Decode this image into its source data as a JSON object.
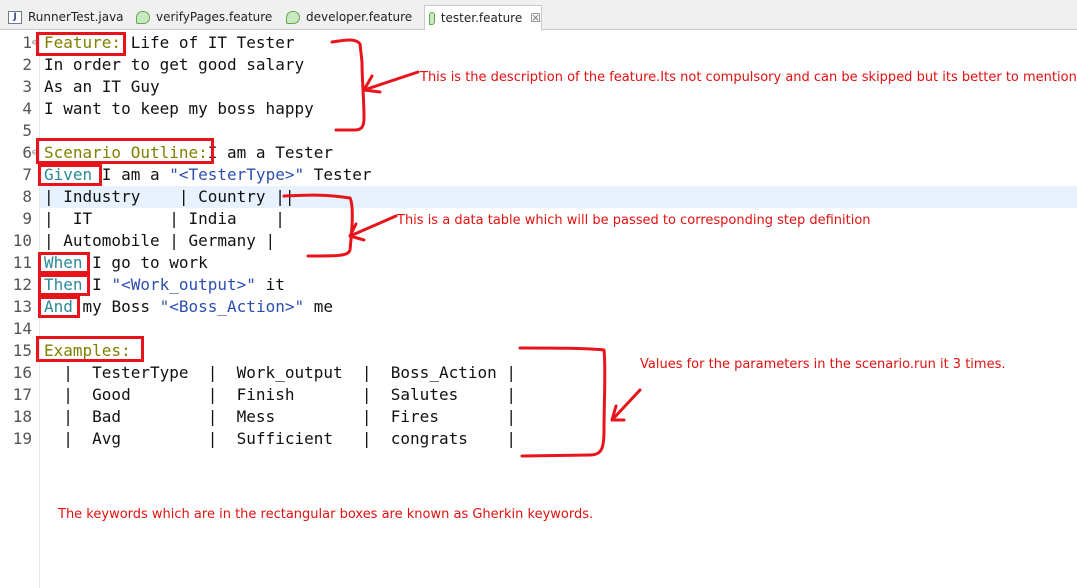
{
  "tabs": [
    {
      "label": "RunnerTest.java",
      "icon": "java-file-icon"
    },
    {
      "label": "verifyPages.feature",
      "icon": "feature-file-icon"
    },
    {
      "label": "developer.feature",
      "icon": "feature-file-icon"
    },
    {
      "label": "tester.feature",
      "icon": "feature-file-icon",
      "active": true,
      "close": "☒"
    }
  ],
  "editor": {
    "lines": [
      {
        "n": "1",
        "parts": [
          [
            "kw1",
            "Feature:"
          ],
          [
            "t",
            " Life of IT Tester"
          ]
        ]
      },
      {
        "n": "2",
        "parts": [
          [
            "t",
            "In order to get good salary"
          ]
        ]
      },
      {
        "n": "3",
        "parts": [
          [
            "t",
            "As an IT Guy"
          ]
        ]
      },
      {
        "n": "4",
        "parts": [
          [
            "t",
            "I want to keep my boss happy"
          ]
        ]
      },
      {
        "n": "5",
        "parts": []
      },
      {
        "n": "6",
        "parts": [
          [
            "kw1",
            "Scenario Outline:"
          ],
          [
            "t",
            "I am a Tester"
          ]
        ]
      },
      {
        "n": "7",
        "parts": [
          [
            "kw2",
            "Given"
          ],
          [
            "t",
            " I am a "
          ],
          [
            "str",
            "\"<TesterType>\""
          ],
          [
            "t",
            " Tester"
          ]
        ]
      },
      {
        "n": "8",
        "parts": [
          [
            "t",
            "| Industry    | Country ||"
          ]
        ]
      },
      {
        "n": "9",
        "parts": [
          [
            "t",
            "|  IT        | India    |"
          ]
        ]
      },
      {
        "n": "10",
        "parts": [
          [
            "t",
            "| Automobile | Germany |"
          ]
        ]
      },
      {
        "n": "11",
        "parts": [
          [
            "kw2",
            "When"
          ],
          [
            "t",
            " I go to work"
          ]
        ]
      },
      {
        "n": "12",
        "parts": [
          [
            "kw2",
            "Then"
          ],
          [
            "t",
            " I "
          ],
          [
            "str",
            "\"<Work_output>\""
          ],
          [
            "t",
            " it"
          ]
        ]
      },
      {
        "n": "13",
        "parts": [
          [
            "kw2",
            "And"
          ],
          [
            "t",
            " my Boss "
          ],
          [
            "str",
            "\"<Boss_Action>\""
          ],
          [
            "t",
            " me"
          ]
        ]
      },
      {
        "n": "14",
        "parts": []
      },
      {
        "n": "15",
        "parts": [
          [
            "kw1",
            "Examples:"
          ]
        ]
      },
      {
        "n": "16",
        "parts": [
          [
            "t",
            "  |  TesterType  |  Work_output  |  Boss_Action |"
          ]
        ]
      },
      {
        "n": "17",
        "parts": [
          [
            "t",
            "  |  Good        |  Finish       |  Salutes     |"
          ]
        ]
      },
      {
        "n": "18",
        "parts": [
          [
            "t",
            "  |  Bad         |  Mess         |  Fires       |"
          ]
        ]
      },
      {
        "n": "19",
        "parts": [
          [
            "t",
            "  |  Avg         |  Sufficient   |  congrats    |"
          ]
        ]
      }
    ]
  },
  "annotations": {
    "description_note": "This is the description of the feature.Its not compulsory and can be skipped but its better to mention",
    "datatable_note": "This is a data table which will be passed to corresponding step definition",
    "examples_note": "Values for the parameters in the scenario.run it 3 times.",
    "keywords_note": "The keywords which are in the rectangular boxes are known as Gherkin keywords."
  },
  "colors": {
    "annotation_red": "#e8141b",
    "keyword_olive": "#7f7f00",
    "keyword_teal": "#2a8a99",
    "string_blue": "#2c4fb0",
    "current_line": "#e8f2fe"
  }
}
